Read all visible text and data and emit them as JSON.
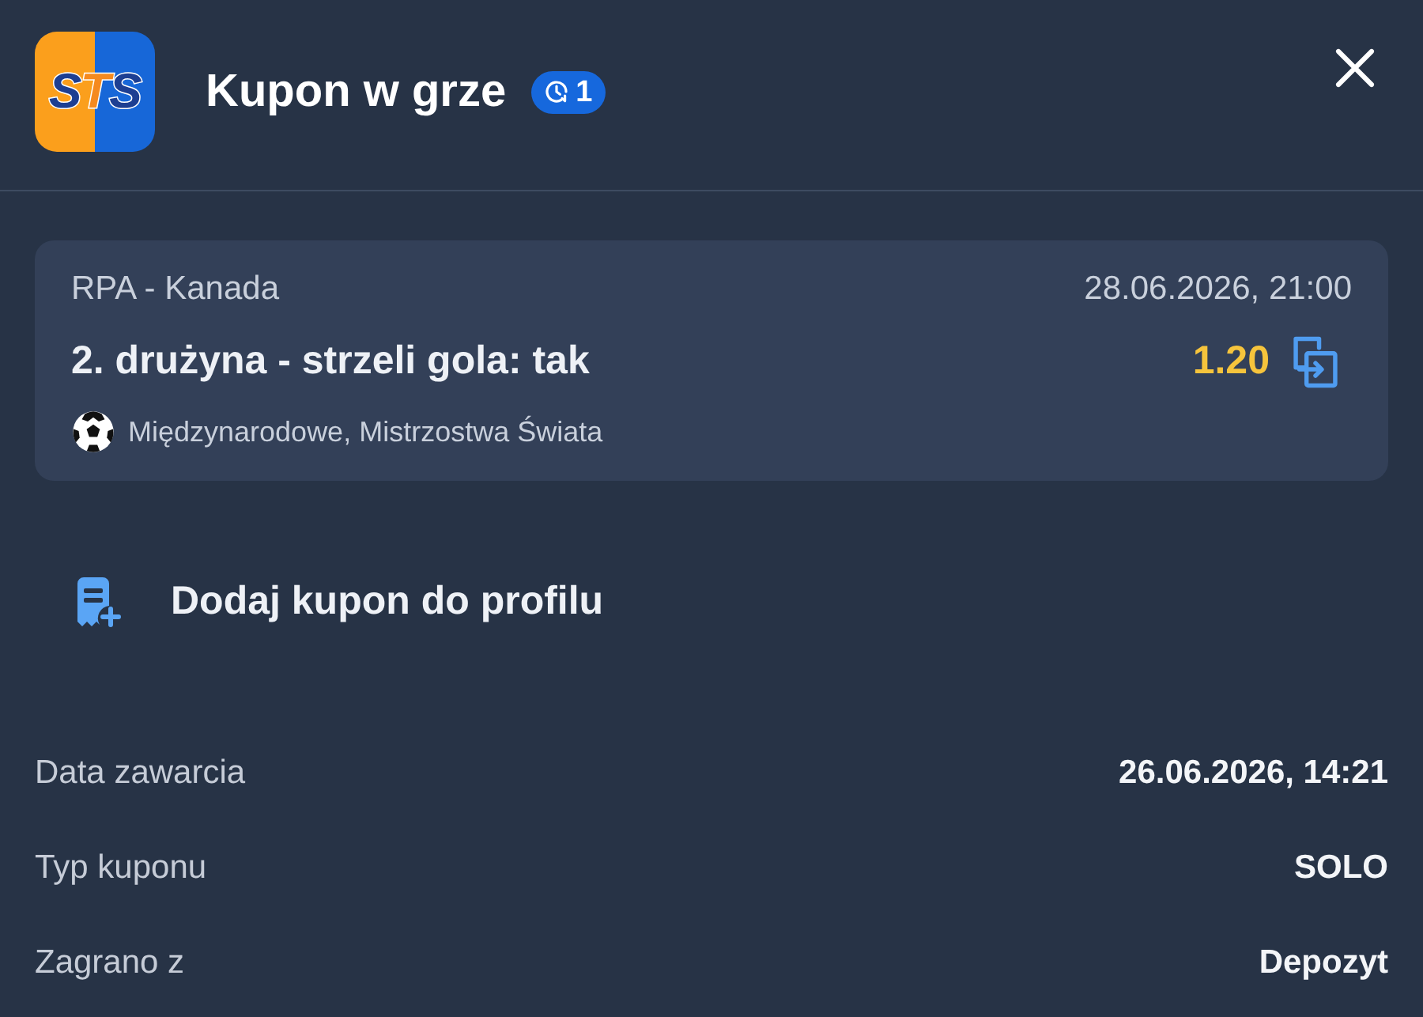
{
  "header": {
    "logo_text": "STS",
    "title": "Kupon w grze",
    "badge": {
      "count": "1"
    }
  },
  "bet": {
    "event": "RPA - Kanada",
    "datetime": "28.06.2026, 21:00",
    "selection": "2. drużyna - strzeli gola: tak",
    "odds": "1.20",
    "competition": "Międzynarodowe, Mistrzostwa Świata"
  },
  "add_to_profile": {
    "label": "Dodaj kupon do profilu"
  },
  "details": [
    {
      "label": "Data zawarcia",
      "value": "26.06.2026, 14:21"
    },
    {
      "label": "Typ kuponu",
      "value": "SOLO"
    },
    {
      "label": "Zagrano z",
      "value": "Depozyt"
    }
  ]
}
